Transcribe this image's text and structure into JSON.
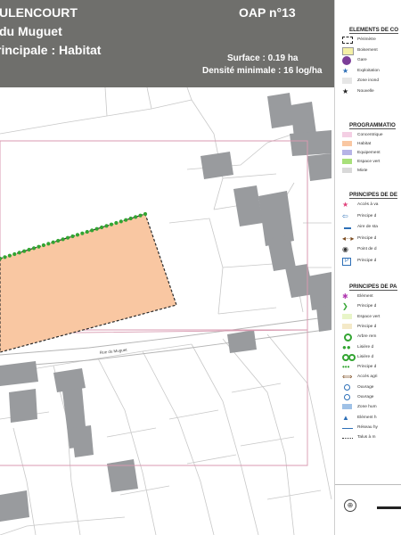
{
  "header": {
    "line1": "ULENCOURT",
    "line2": "du Muguet",
    "line3": "rincipale : Habitat",
    "oap_title": "OAP n°13",
    "surface": "Surface : 0.19 ha",
    "density": "Densité minimale : 16 log/ha"
  },
  "map": {
    "street_label": "Rue du Muguet"
  },
  "legend": {
    "colors": {
      "habitat": "#f9c7a2",
      "concentric": "#f4cfe4",
      "equipment": "#b6b4e6",
      "green": "#a8e07a",
      "mixed": "#d9d9d9",
      "boisement": "#f4f0a6",
      "purple": "#7b3e98",
      "blue": "#2d6fb7",
      "brown": "#7a4a1e",
      "bright_green": "#33a532"
    },
    "sections": [
      {
        "title": "ELEMENTS DE CO",
        "items": [
          {
            "sym": "dash-rect",
            "label": "Périmètre"
          },
          {
            "sym": "boisement",
            "label": "Boisement"
          },
          {
            "sym": "gare",
            "label": "Gare"
          },
          {
            "sym": "star-blue",
            "label": "Exploitation"
          },
          {
            "sym": "zone-grey",
            "label": "Zone inond"
          },
          {
            "sym": "star-black",
            "label": "Nouvelle"
          }
        ]
      },
      {
        "title": "PROGRAMMATIO",
        "items": [
          {
            "sym": "fill-concentric",
            "label": "Concentrique"
          },
          {
            "sym": "fill-habitat",
            "label": "Habitat"
          },
          {
            "sym": "fill-equip",
            "label": "Equipement"
          },
          {
            "sym": "fill-green",
            "label": "Espace vert"
          },
          {
            "sym": "fill-mixed",
            "label": "Mixte"
          }
        ]
      },
      {
        "title": "PRINCIPES DE DE",
        "items": [
          {
            "sym": "star-pink",
            "label": "Accès à va"
          },
          {
            "sym": "arrow-blue",
            "label": "Principe d"
          },
          {
            "sym": "dash-blue",
            "label": "Aire de sta"
          },
          {
            "sym": "arrow-brown",
            "label": "Principe d"
          },
          {
            "sym": "target",
            "label": "Point de d"
          },
          {
            "sym": "parking",
            "label": "Principe d"
          }
        ]
      },
      {
        "title": "PRINCIPES DE PA",
        "items": [
          {
            "sym": "asterisk-purple",
            "label": "Elément"
          },
          {
            "sym": "chevron-green",
            "label": "Principe d"
          },
          {
            "sym": "fill-lightgreen",
            "label": "Espace vert"
          },
          {
            "sym": "fill-beige",
            "label": "Principe d"
          },
          {
            "sym": "circle-green",
            "label": "Arbre rem"
          },
          {
            "sym": "tree-row",
            "label": "Lisière d"
          },
          {
            "sym": "double-circle",
            "label": "Lisière d"
          },
          {
            "sym": "dots-green",
            "label": "Principe d"
          },
          {
            "sym": "arrow-both",
            "label": "Accès agri"
          },
          {
            "sym": "circle-blue",
            "label": "Ouvrage"
          },
          {
            "sym": "circle-blue2",
            "label": "Ouvrage"
          },
          {
            "sym": "rect-blue",
            "label": "Zone hum"
          },
          {
            "sym": "triangle-blue",
            "label": "Elément h"
          },
          {
            "sym": "line-blue",
            "label": "Réseau hy"
          },
          {
            "sym": "dots-line",
            "label": "Talus à m"
          }
        ]
      }
    ]
  }
}
